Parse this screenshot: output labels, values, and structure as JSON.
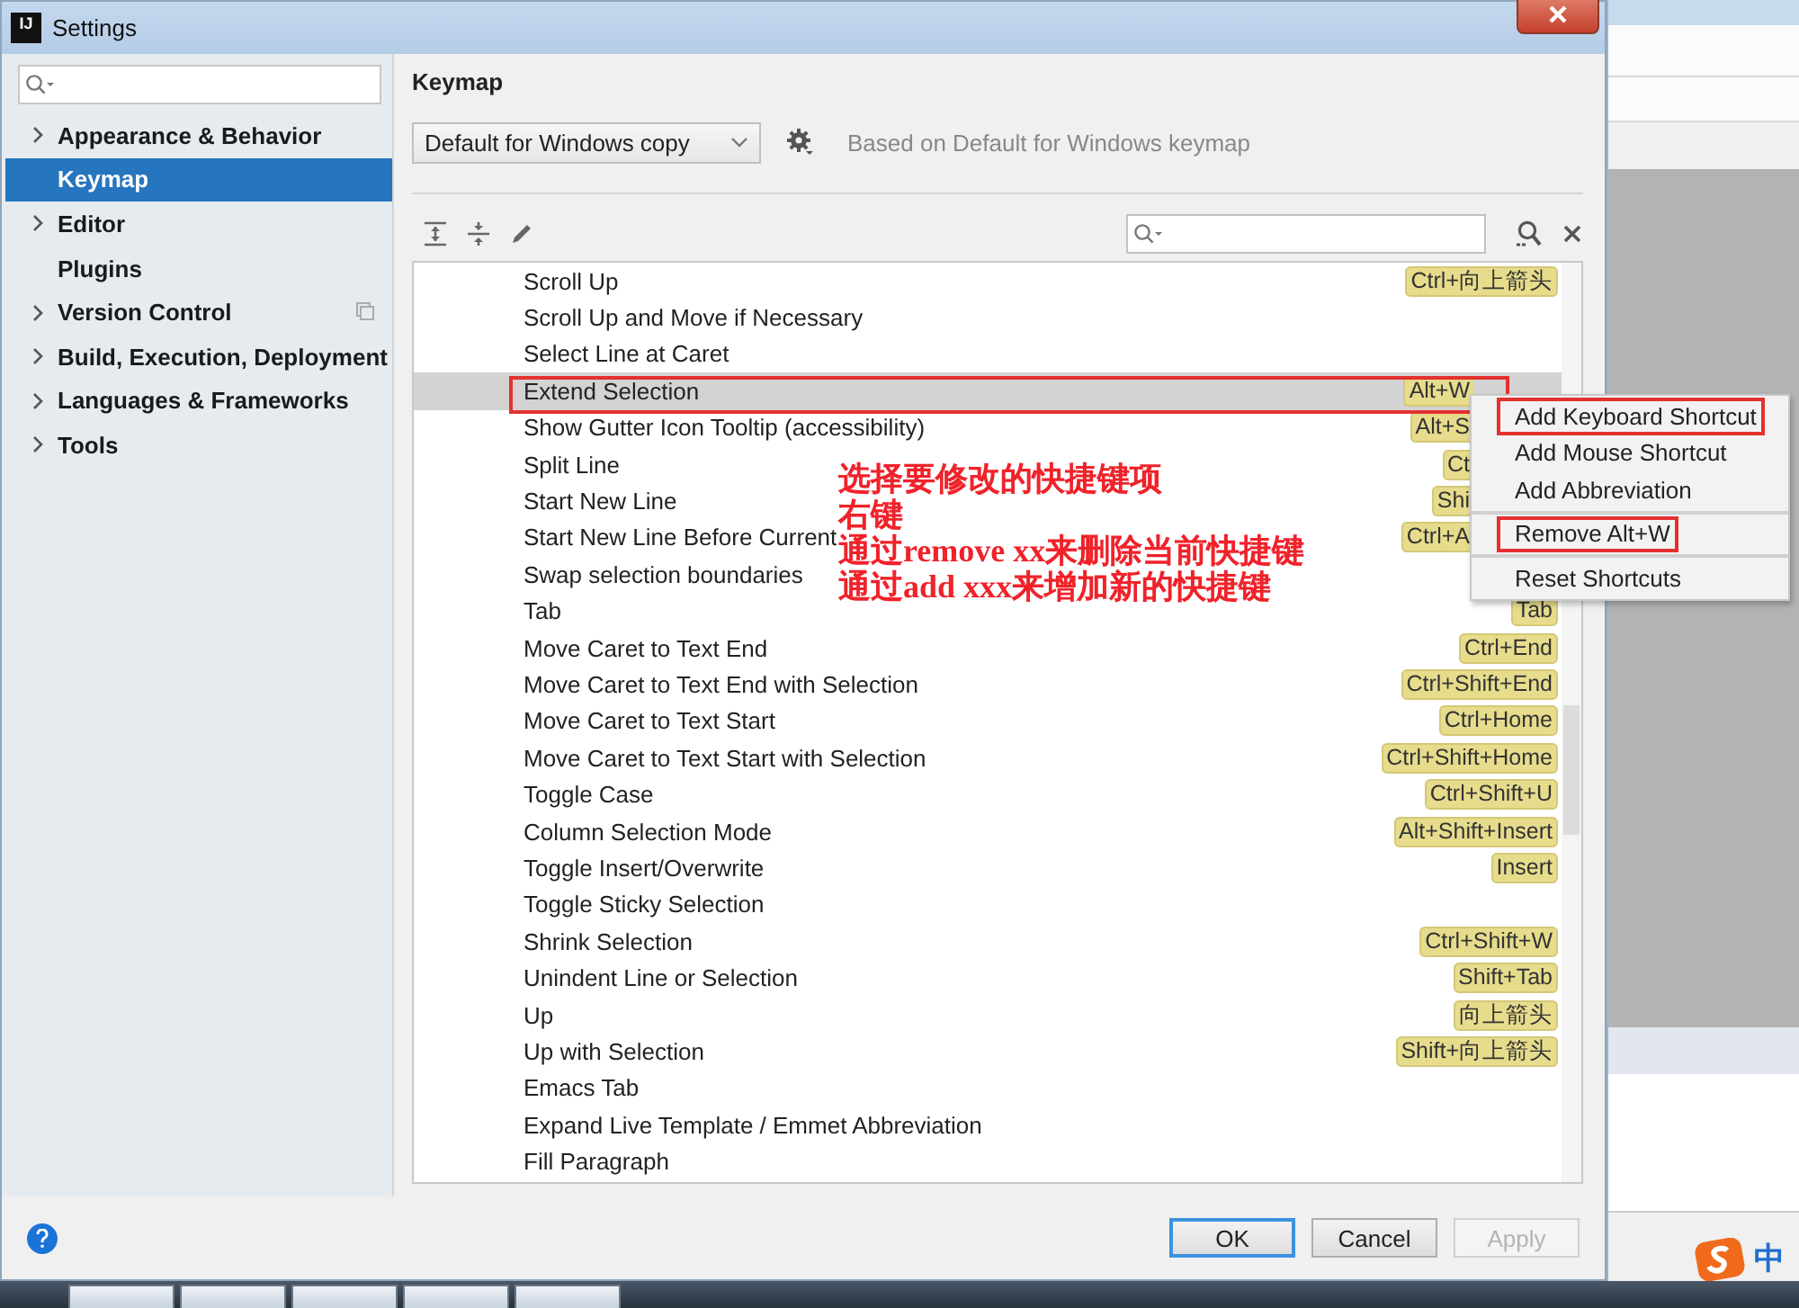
{
  "window": {
    "icon_text": "IJ",
    "title": "Settings"
  },
  "sidebar": {
    "items": [
      {
        "label": "Appearance & Behavior",
        "expandable": true,
        "selected": false,
        "project_scope": false
      },
      {
        "label": "Keymap",
        "expandable": false,
        "selected": true,
        "project_scope": false
      },
      {
        "label": "Editor",
        "expandable": true,
        "selected": false,
        "project_scope": false
      },
      {
        "label": "Plugins",
        "expandable": false,
        "selected": false,
        "project_scope": false
      },
      {
        "label": "Version Control",
        "expandable": true,
        "selected": false,
        "project_scope": true
      },
      {
        "label": "Build, Execution, Deployment",
        "expandable": true,
        "selected": false,
        "project_scope": false
      },
      {
        "label": "Languages & Frameworks",
        "expandable": true,
        "selected": false,
        "project_scope": false
      },
      {
        "label": "Tools",
        "expandable": true,
        "selected": false,
        "project_scope": false
      }
    ]
  },
  "keymap": {
    "heading": "Keymap",
    "scheme": "Default for Windows copy",
    "based_on": "Based on Default for Windows keymap"
  },
  "actions": [
    {
      "name": "Scroll Up",
      "shortcut": "Ctrl+向上箭头",
      "clipped": false,
      "selected": false
    },
    {
      "name": "Scroll Up and Move if Necessary",
      "selected": false
    },
    {
      "name": "Select Line at Caret",
      "selected": false
    },
    {
      "name": "Extend Selection",
      "shortcut": "Alt+W",
      "clipped": true,
      "selected": true
    },
    {
      "name": "Show Gutter Icon Tooltip (accessibility)",
      "shortcut": "Alt+S",
      "clipped": true,
      "selected": false
    },
    {
      "name": "Split Line",
      "shortcut": "Ct",
      "clipped": true,
      "selected": false
    },
    {
      "name": "Start New Line",
      "shortcut": "Shi",
      "clipped": true,
      "selected": false
    },
    {
      "name": "Start New Line Before Current",
      "shortcut": "Ctrl+A",
      "clipped": true,
      "selected": false
    },
    {
      "name": "Swap selection boundaries",
      "selected": false
    },
    {
      "name": "Tab",
      "shortcut": "Tab",
      "clipped": false,
      "selected": false
    },
    {
      "name": "Move Caret to Text End",
      "shortcut": "Ctrl+End",
      "clipped": false,
      "selected": false
    },
    {
      "name": "Move Caret to Text End with Selection",
      "shortcut": "Ctrl+Shift+End",
      "clipped": false,
      "selected": false
    },
    {
      "name": "Move Caret to Text Start",
      "shortcut": "Ctrl+Home",
      "clipped": false,
      "selected": false
    },
    {
      "name": "Move Caret to Text Start with Selection",
      "shortcut": "Ctrl+Shift+Home",
      "clipped": false,
      "selected": false
    },
    {
      "name": "Toggle Case",
      "shortcut": "Ctrl+Shift+U",
      "clipped": false,
      "selected": false
    },
    {
      "name": "Column Selection Mode",
      "shortcut": "Alt+Shift+Insert",
      "clipped": false,
      "selected": false
    },
    {
      "name": "Toggle Insert/Overwrite",
      "shortcut": "Insert",
      "clipped": false,
      "selected": false
    },
    {
      "name": "Toggle Sticky Selection",
      "selected": false
    },
    {
      "name": "Shrink Selection",
      "shortcut": "Ctrl+Shift+W",
      "clipped": false,
      "selected": false
    },
    {
      "name": "Unindent Line or Selection",
      "shortcut": "Shift+Tab",
      "clipped": false,
      "selected": false
    },
    {
      "name": "Up",
      "shortcut": "向上箭头",
      "clipped": false,
      "selected": false
    },
    {
      "name": "Up with Selection",
      "shortcut": "Shift+向上箭头",
      "clipped": false,
      "selected": false
    },
    {
      "name": "Emacs Tab",
      "selected": false
    },
    {
      "name": "Expand Live Template / Emmet Abbreviation",
      "selected": false
    },
    {
      "name": "Fill Paragraph",
      "selected": false
    }
  ],
  "context_menu": [
    {
      "label": "Add Keyboard Shortcut",
      "separator_before": false,
      "highlighted": true
    },
    {
      "label": "Add Mouse Shortcut",
      "separator_before": false,
      "highlighted": false
    },
    {
      "label": "Add Abbreviation",
      "separator_before": false,
      "highlighted": false
    },
    {
      "label": "Remove Alt+W",
      "separator_before": true,
      "highlighted": true
    },
    {
      "label": "Reset Shortcuts",
      "separator_before": true,
      "highlighted": false
    }
  ],
  "annotation": {
    "lines": [
      "选择要修改的快捷键项",
      "右键",
      "通过remove  xx来删除当前快捷键",
      "通过add  xxx来增加新的快捷键"
    ]
  },
  "buttons": [
    {
      "label": "OK",
      "focused": true,
      "disabled": false
    },
    {
      "label": "Cancel",
      "focused": false,
      "disabled": false
    },
    {
      "label": "Apply",
      "focused": false,
      "disabled": true
    }
  ],
  "tray": {
    "ime_label": "中"
  }
}
